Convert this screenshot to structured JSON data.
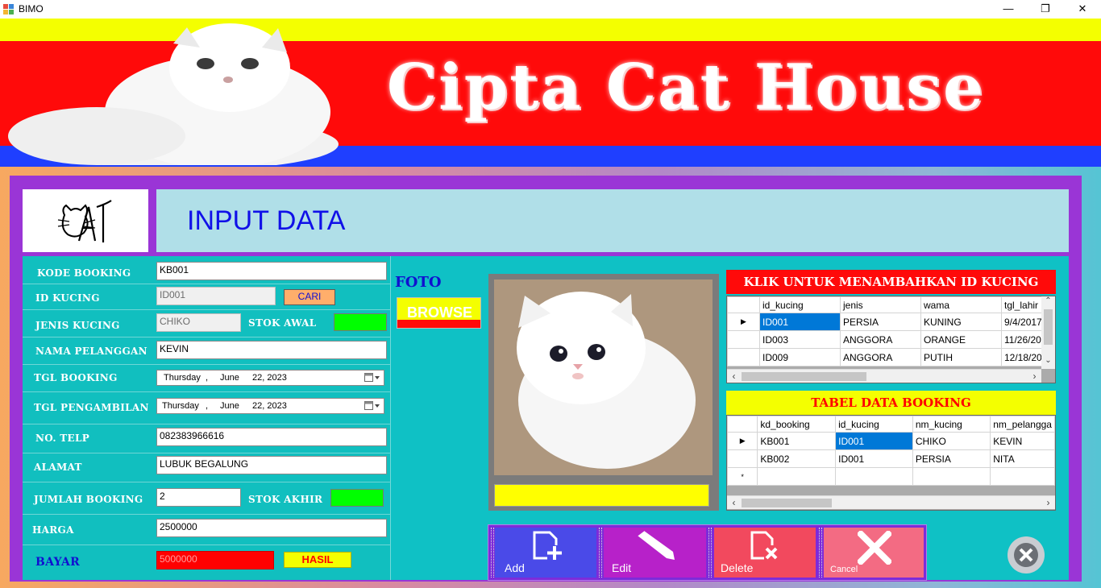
{
  "window": {
    "title": "BIMO",
    "minimize_glyph": "—",
    "maximize_glyph": "❐",
    "close_glyph": "✕"
  },
  "banner": {
    "brand": "Cipta Cat House"
  },
  "header": {
    "title": "INPUT DATA"
  },
  "form": {
    "kode_booking_label": "KODE BOOKING",
    "kode_booking": "KB001",
    "id_kucing_label": "ID KUCING",
    "id_kucing": "ID001",
    "cari_label": "CARI",
    "jenis_kucing_label": "JENIS KUCING",
    "jenis_kucing": "CHIKO",
    "stok_awal_label": "STOK AWAL",
    "nama_pelanggan_label": "NAMA PELANGGAN",
    "nama_pelanggan": "KEVIN",
    "tgl_booking_label": "TGL BOOKING",
    "tgl_booking": {
      "day": "Thursday",
      "sep": ",",
      "month": "June",
      "date": "22, 2023"
    },
    "tgl_pengambilan_label": "TGL PENGAMBILAN",
    "tgl_pengambilan": {
      "day": "Thursday",
      "sep": ",",
      "month": "June",
      "date": "22, 2023"
    },
    "no_telp_label": "NO. TELP",
    "no_telp": "082383966616",
    "alamat_label": "ALAMAT",
    "alamat": "LUBUK BEGALUNG",
    "jumlah_booking_label": "JUMLAH BOOKING",
    "jumlah_booking": "2",
    "stok_akhir_label": "STOK AKHIR",
    "harga_label": "HARGA",
    "harga": "2500000",
    "bayar_label": "BAYAR",
    "bayar": "5000000",
    "hasil_label": "HASIL"
  },
  "foto": {
    "label": "FOTO",
    "browse_label": "BROWSE"
  },
  "kucing_grid": {
    "title": "KLIK UNTUK MENAMBAHKAN ID KUCING",
    "columns": [
      "id_kucing",
      "jenis",
      "wama",
      "tgl_lahir"
    ],
    "rows": [
      [
        "ID001",
        "PERSIA",
        "KUNING",
        "9/4/2017"
      ],
      [
        "ID003",
        "ANGGORA",
        "ORANGE",
        "11/26/20"
      ],
      [
        "ID009",
        "ANGGORA",
        "PUTIH",
        "12/18/20"
      ]
    ]
  },
  "booking_grid": {
    "title": "TABEL DATA BOOKING",
    "columns": [
      "kd_booking",
      "id_kucing",
      "nm_kucing",
      "nm_pelangga"
    ],
    "rows": [
      [
        "KB001",
        "ID001",
        "CHIKO",
        "KEVIN"
      ],
      [
        "KB002",
        "ID001",
        "PERSIA",
        "NITA"
      ]
    ],
    "new_row_marker": "*"
  },
  "actions": {
    "add": "Add",
    "edit": "Edit",
    "delete": "Delete",
    "cancel": "Cancel"
  },
  "colors": {
    "frame": "#9a35d6",
    "content": "#0fc1c5",
    "header_text": "#1010e8",
    "accent_red": "#ff0a0a",
    "accent_yellow": "#f4ff00",
    "accent_blue": "#1f3fff"
  }
}
